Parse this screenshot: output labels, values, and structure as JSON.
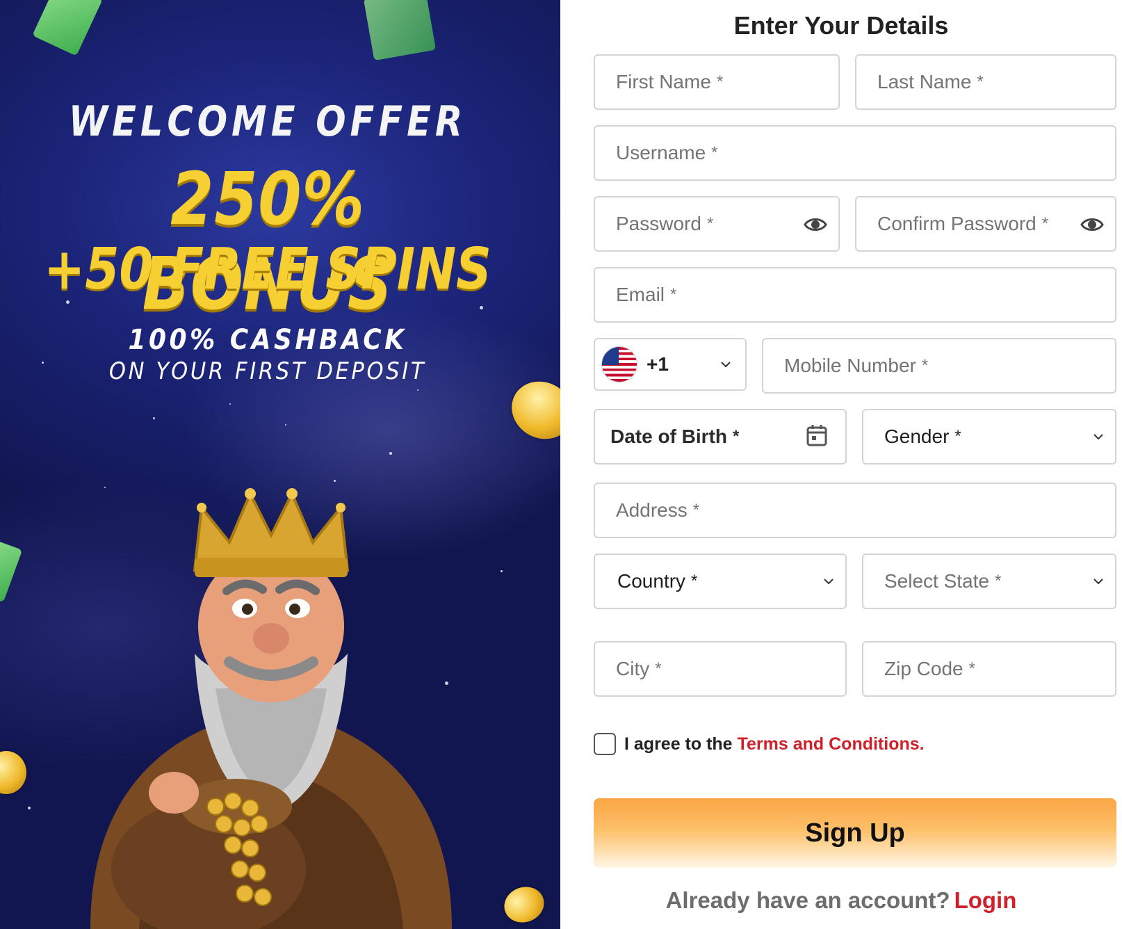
{
  "promo": {
    "welcome": "WELCOME OFFER",
    "bonus": "250% BONUS",
    "spins": "+50 FREE SPINS",
    "cashback": "100% CASHBACK",
    "deposit": "ON YOUR FIRST DEPOSIT"
  },
  "form": {
    "title": "Enter Your Details",
    "first_name": "First Name",
    "last_name": "Last Name",
    "username": "Username",
    "password": "Password",
    "confirm_password": "Confirm Password",
    "email": "Email",
    "dial_code": "+1",
    "mobile": "Mobile Number",
    "dob": "Date of Birth",
    "gender": "Gender",
    "address": "Address",
    "country": "Country",
    "state": "Select State",
    "city": "City",
    "zip": "Zip Code",
    "required_mark": "*"
  },
  "agree": {
    "text": "I agree to the",
    "terms": "Terms and Conditions."
  },
  "signup_label": "Sign Up",
  "login": {
    "prompt": "Already have an account?",
    "link": "Login"
  },
  "colors": {
    "accent_red": "#d0202a",
    "button_orange": "#fca645",
    "promo_yellow": "#f6cf32",
    "promo_bg": "#1b2478"
  },
  "icons": [
    "eye-icon",
    "chevron-down-icon",
    "calendar-icon",
    "us-flag-icon",
    "coin-icon",
    "cash-bill-icon"
  ]
}
